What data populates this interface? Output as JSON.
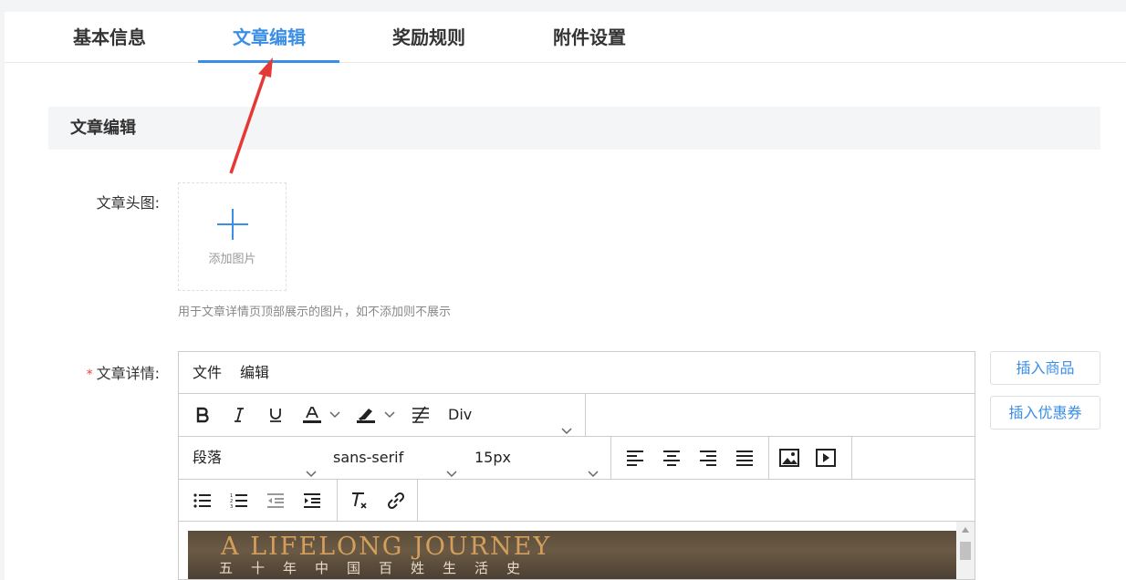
{
  "tabs": [
    {
      "label": "基本信息"
    },
    {
      "label": "文章编辑"
    },
    {
      "label": "奖励规则"
    },
    {
      "label": "附件设置"
    }
  ],
  "active_tab": "文章编辑",
  "section": {
    "title": "文章编辑"
  },
  "form": {
    "cover_label": "文章头图:",
    "upload_text": "添加图片",
    "cover_hint": "用于文章详情页顶部展示的图片，如不添加则不展示",
    "required_mark": "*",
    "detail_label": "文章详情:"
  },
  "editor": {
    "menubar": [
      "文件",
      "编辑"
    ],
    "block_format": "Div",
    "paragraph_format": "段落",
    "font_family": "sans-serif",
    "font_size": "15px",
    "content": {
      "poster_title": "A LIFELONG JOURNEY",
      "poster_subtitle": "五十年中国百姓生活史"
    }
  },
  "side_buttons": {
    "insert_product": "插入商品",
    "insert_coupon": "插入优惠券"
  },
  "colors": {
    "accent": "#3a8ee6",
    "required": "#e64340",
    "annotation_arrow": "#e53935"
  }
}
